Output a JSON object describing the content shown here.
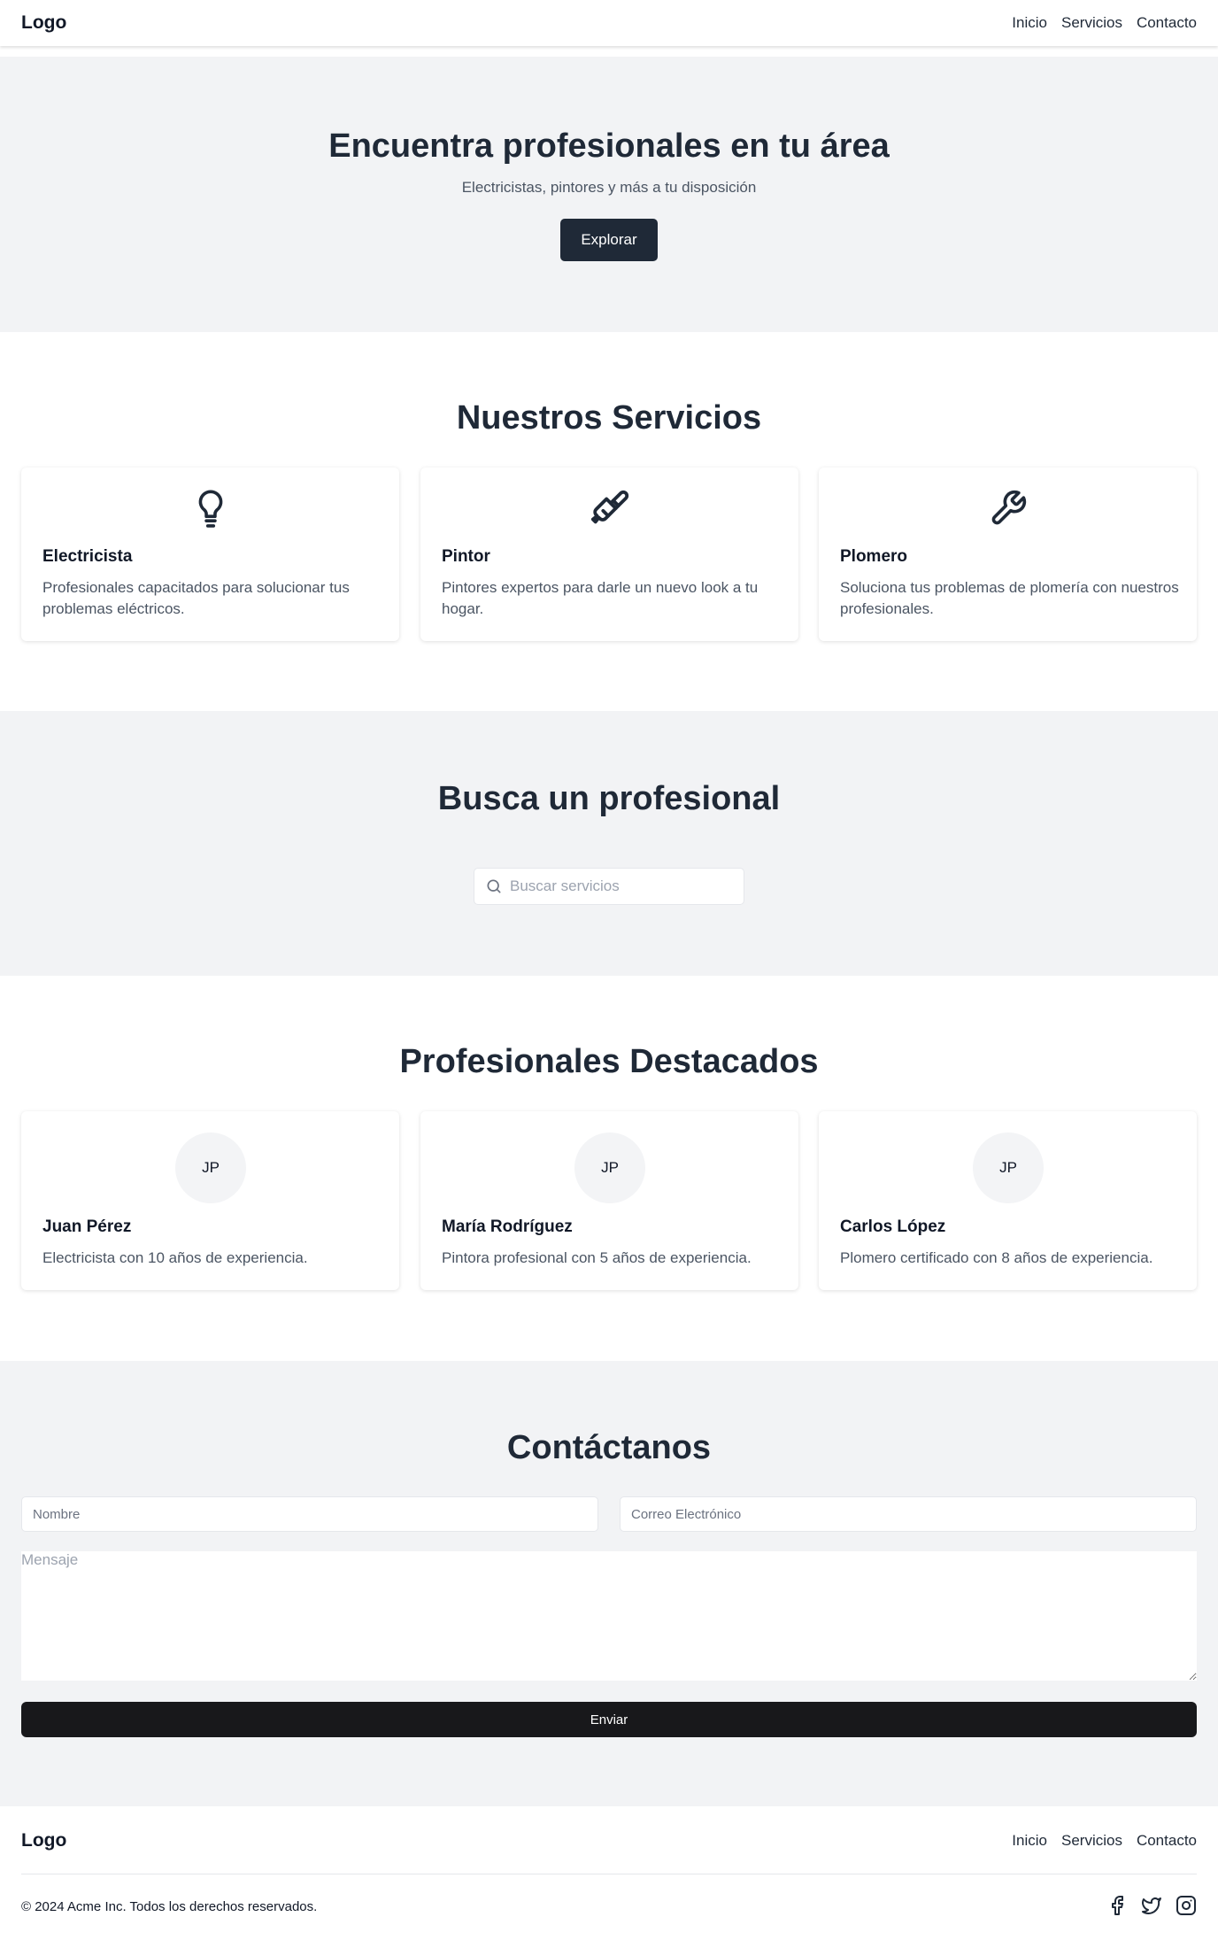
{
  "header": {
    "logo": "Logo",
    "nav": [
      "Inicio",
      "Servicios",
      "Contacto"
    ]
  },
  "hero": {
    "title": "Encuentra profesionales en tu área",
    "subtitle": "Electricistas, pintores y más a tu disposición",
    "button": "Explorar"
  },
  "services": {
    "title": "Nuestros Servicios",
    "items": [
      {
        "icon": "lightbulb-icon",
        "title": "Electricista",
        "text": "Profesionales capacitados para solucionar tus problemas eléctricos."
      },
      {
        "icon": "paintbrush-icon",
        "title": "Pintor",
        "text": "Pintores expertos para darle un nuevo look a tu hogar."
      },
      {
        "icon": "wrench-icon",
        "title": "Plomero",
        "text": "Soluciona tus problemas de plomería con nuestros profesionales."
      }
    ]
  },
  "search": {
    "title": "Busca un profesional",
    "placeholder": "Buscar servicios"
  },
  "featured": {
    "title": "Profesionales Destacados",
    "items": [
      {
        "initials": "JP",
        "name": "Juan Pérez",
        "text": "Electricista con 10 años de experiencia."
      },
      {
        "initials": "JP",
        "name": "María Rodríguez",
        "text": "Pintora profesional con 5 años de experiencia."
      },
      {
        "initials": "JP",
        "name": "Carlos López",
        "text": "Plomero certificado con 8 años de experiencia."
      }
    ]
  },
  "contact": {
    "title": "Contáctanos",
    "name_placeholder": "Nombre",
    "email_placeholder": "Correo Electrónico",
    "message_placeholder": "Mensaje",
    "submit": "Enviar"
  },
  "footer": {
    "logo": "Logo",
    "nav": [
      "Inicio",
      "Servicios",
      "Contacto"
    ],
    "copyright": "© 2024 Acme Inc. Todos los derechos reservados.",
    "social_icons": [
      "facebook-icon",
      "twitter-icon",
      "instagram-icon"
    ]
  },
  "colors": {
    "primary_dark": "#1f2937",
    "section_bg": "#f2f3f5",
    "submit_bg": "#18181b"
  }
}
